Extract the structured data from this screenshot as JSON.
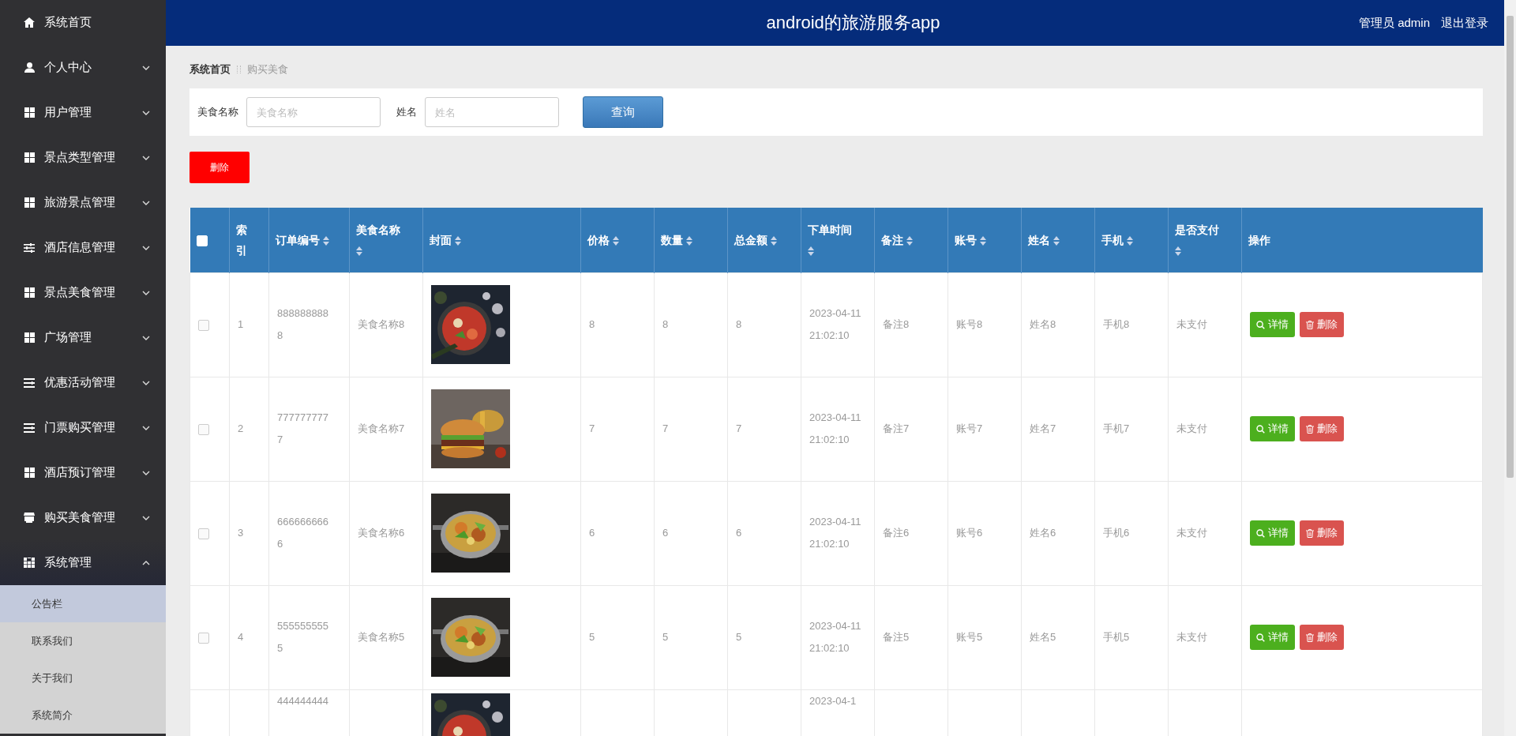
{
  "sidebar": {
    "items": [
      {
        "label": "系统首页"
      },
      {
        "label": "个人中心",
        "expanded": false
      },
      {
        "label": "用户管理",
        "expanded": false
      },
      {
        "label": "景点类型管理",
        "expanded": false
      },
      {
        "label": "旅游景点管理",
        "expanded": false
      },
      {
        "label": "酒店信息管理",
        "expanded": false
      },
      {
        "label": "景点美食管理",
        "expanded": false
      },
      {
        "label": "广场管理",
        "expanded": false
      },
      {
        "label": "优惠活动管理",
        "expanded": false
      },
      {
        "label": "门票购买管理",
        "expanded": false
      },
      {
        "label": "酒店预订管理",
        "expanded": false
      },
      {
        "label": "购买美食管理",
        "expanded": false
      },
      {
        "label": "系统管理",
        "expanded": true,
        "children": [
          {
            "label": "公告栏",
            "selected": true
          },
          {
            "label": "联系我们",
            "selected": false
          },
          {
            "label": "关于我们",
            "selected": false
          },
          {
            "label": "系统简介",
            "selected": false
          }
        ]
      }
    ]
  },
  "header": {
    "title": "android的旅游服务app",
    "user": "管理员 admin",
    "logout": "退出登录"
  },
  "breadcrumb": [
    {
      "label": "系统首页"
    },
    {
      "label": "购买美食"
    }
  ],
  "search": {
    "fields": [
      {
        "label": "美食名称",
        "placeholder": "美食名称"
      },
      {
        "label": "姓名",
        "placeholder": "姓名"
      }
    ],
    "button": "查询"
  },
  "delete_button": "删除",
  "table": {
    "header_checked": false,
    "columns": [
      {
        "label": "索引",
        "sortable": false
      },
      {
        "label": "订单编号",
        "sortable": true
      },
      {
        "label": "美食名称",
        "sortable": true
      },
      {
        "label": "封面",
        "sortable": true
      },
      {
        "label": "价格",
        "sortable": true
      },
      {
        "label": "数量",
        "sortable": true
      },
      {
        "label": "总金额",
        "sortable": true
      },
      {
        "label": "下单时间",
        "sortable": true
      },
      {
        "label": "备注",
        "sortable": true
      },
      {
        "label": "账号",
        "sortable": true
      },
      {
        "label": "姓名",
        "sortable": true
      },
      {
        "label": "手机",
        "sortable": true
      },
      {
        "label": "是否支付",
        "sortable": true
      },
      {
        "label": "操作",
        "sortable": false
      }
    ],
    "rows": [
      {
        "checked": false,
        "index": "1",
        "order_no": "8888888888",
        "food": "美食名称8",
        "price": "8",
        "qty": "8",
        "total": "8",
        "time": "2023-04-11 21:02:10",
        "note": "备注8",
        "account": "账号8",
        "name": "姓名8",
        "phone": "手机8",
        "paid": "未支付",
        "actions": [
          "详情",
          "删除"
        ]
      },
      {
        "checked": false,
        "index": "2",
        "order_no": "7777777777",
        "food": "美食名称7",
        "price": "7",
        "qty": "7",
        "total": "7",
        "time": "2023-04-11 21:02:10",
        "note": "备注7",
        "account": "账号7",
        "name": "姓名7",
        "phone": "手机7",
        "paid": "未支付",
        "actions": [
          "详情",
          "删除"
        ]
      },
      {
        "checked": false,
        "index": "3",
        "order_no": "6666666666",
        "food": "美食名称6",
        "price": "6",
        "qty": "6",
        "total": "6",
        "time": "2023-04-11 21:02:10",
        "note": "备注6",
        "account": "账号6",
        "name": "姓名6",
        "phone": "手机6",
        "paid": "未支付",
        "actions": [
          "详情",
          "删除"
        ]
      },
      {
        "checked": false,
        "index": "4",
        "order_no": "5555555555",
        "food": "美食名称5",
        "price": "5",
        "qty": "5",
        "total": "5",
        "time": "2023-04-11 21:02:10",
        "note": "备注5",
        "account": "账号5",
        "name": "姓名5",
        "phone": "手机5",
        "paid": "未支付",
        "actions": [
          "详情",
          "删除"
        ]
      },
      {
        "order_no": "444444444",
        "time": "2023-04-1"
      }
    ]
  }
}
